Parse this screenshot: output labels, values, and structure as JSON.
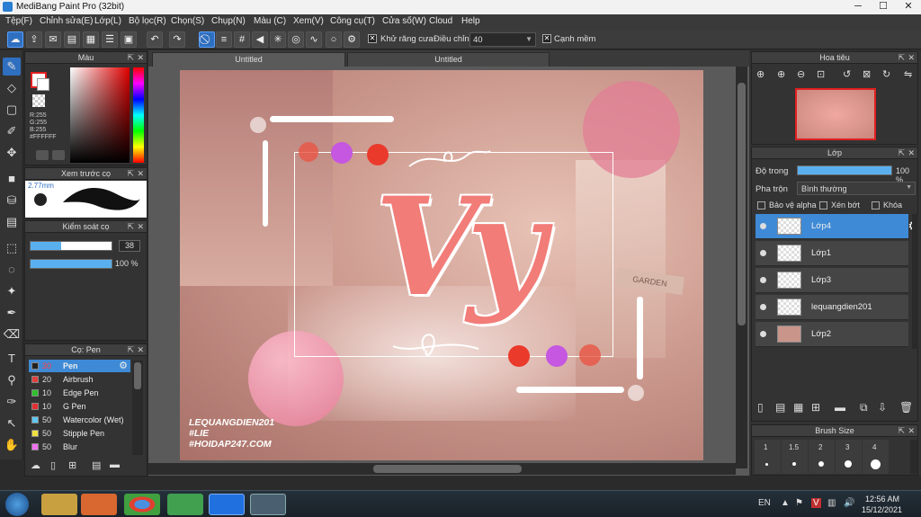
{
  "window": {
    "title": "MediBang Paint Pro (32bit)",
    "min": "─",
    "max": "☐",
    "close": "✕"
  },
  "menu": [
    "Tệp(F)",
    "Chỉnh sửa(E)",
    "Lớp(L)",
    "Bộ lọc(R)",
    "Chọn(S)",
    "Chụp(N)",
    "Màu (C)",
    "Xem(V)",
    "Công cụ(T)",
    "Cửa số(W)",
    "Cloud",
    "Help"
  ],
  "toolbar": {
    "antialias_label": "Khử răng cưa",
    "adjust_label": "Điều chỉnh",
    "adjust_value": "40",
    "smooth_label": "Cạnh mềm"
  },
  "color_panel": {
    "title": "Màu",
    "r": "R:255",
    "g": "G:255",
    "b": "B:255",
    "hex": "#FFFFFF",
    "primary": "#e02020",
    "secondary": "#ffffff"
  },
  "brush_preview": {
    "title": "Xem trước cọ",
    "size": "2.77mm"
  },
  "brush_control": {
    "title": "Kiểm soát cọ",
    "size": "38",
    "opacity": "100 %",
    "size_fill": 0.38,
    "opacity_fill": 1.0
  },
  "brush_panel": {
    "title": "Cọ: Pen",
    "items": [
      {
        "num": "30",
        "name": "Pen",
        "color": "#222222",
        "selected": true
      },
      {
        "num": "20",
        "name": "Airbrush",
        "color": "#e04040"
      },
      {
        "num": "10",
        "name": "Edge Pen",
        "color": "#2fbf2f"
      },
      {
        "num": "10",
        "name": "G Pen",
        "color": "#e03030"
      },
      {
        "num": "50",
        "name": "Watercolor (Wet)",
        "color": "#5fc6f0"
      },
      {
        "num": "50",
        "name": "Stipple Pen",
        "color": "#f0e040"
      },
      {
        "num": "50",
        "name": "Blur",
        "color": "#f070f0"
      }
    ]
  },
  "tabs": [
    "Untitled",
    "Untitled"
  ],
  "artwork": {
    "lettering": "Vy",
    "watermark": [
      "LEQUANGDIEN201",
      "#LIE",
      "#HOIDAP247.COM"
    ],
    "sign": "GARDEN"
  },
  "navigator": {
    "title": "Hoa tiêu"
  },
  "layer_panel": {
    "title": "Lớp",
    "opacity_label": "Độ trong",
    "opacity_value": "100 %",
    "opacity_fill": 1.0,
    "blend_label": "Pha trộn",
    "blend_value": "Bình thường",
    "protect_alpha": "Bảo vệ alpha",
    "clip": "Xén bớt",
    "lock": "Khóa",
    "layers": [
      {
        "name": "Lớp4",
        "selected": true
      },
      {
        "name": "Lớp1"
      },
      {
        "name": "Lớp3"
      },
      {
        "name": "lequangdien201"
      },
      {
        "name": "Lớp2"
      }
    ]
  },
  "brush_size": {
    "title": "Brush Size",
    "sizes": [
      "1",
      "1.5",
      "2",
      "3",
      "4"
    ]
  },
  "taskbar": {
    "lang": "EN",
    "time": "12:56 AM",
    "date": "15/12/2021"
  }
}
